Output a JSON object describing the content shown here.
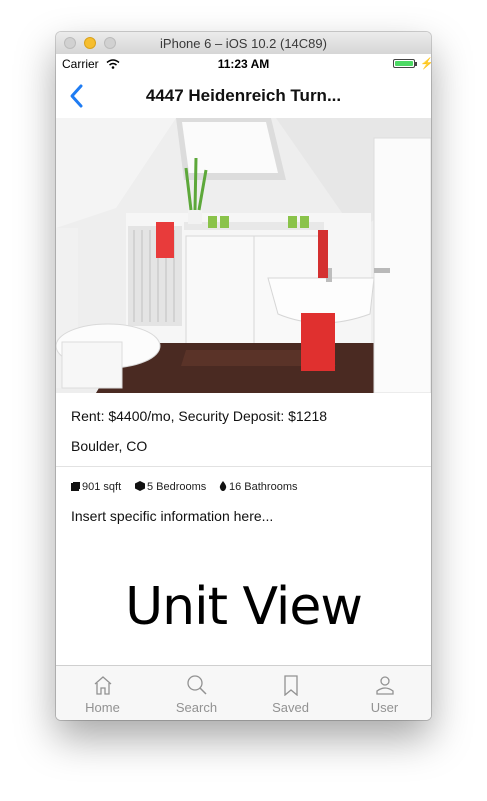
{
  "window": {
    "title": "iPhone 6 – iOS 10.2 (14C89)"
  },
  "status_bar": {
    "carrier": "Carrier",
    "time": "11:23 AM",
    "battery_percent": 100
  },
  "nav": {
    "title": "4447 Heidenreich Turn..."
  },
  "listing": {
    "rent_line": "Rent: $4400/mo, Security Deposit: $1218",
    "location": "Boulder, CO",
    "features": [
      {
        "icon": "square-icon",
        "label": "901 sqft"
      },
      {
        "icon": "cube-icon",
        "label": "5 Bedrooms"
      },
      {
        "icon": "drop-icon",
        "label": "16 Bathrooms"
      }
    ],
    "description": "Insert specific information here...",
    "view_label": "Unit View"
  },
  "tabs": [
    {
      "label": "Home",
      "icon": "home-icon"
    },
    {
      "label": "Search",
      "icon": "search-icon"
    },
    {
      "label": "Saved",
      "icon": "bookmark-icon"
    },
    {
      "label": "User",
      "icon": "user-icon"
    }
  ],
  "colors": {
    "accent": "#1f7cf3",
    "tab_inactive": "#929292",
    "battery": "#4cd964"
  }
}
